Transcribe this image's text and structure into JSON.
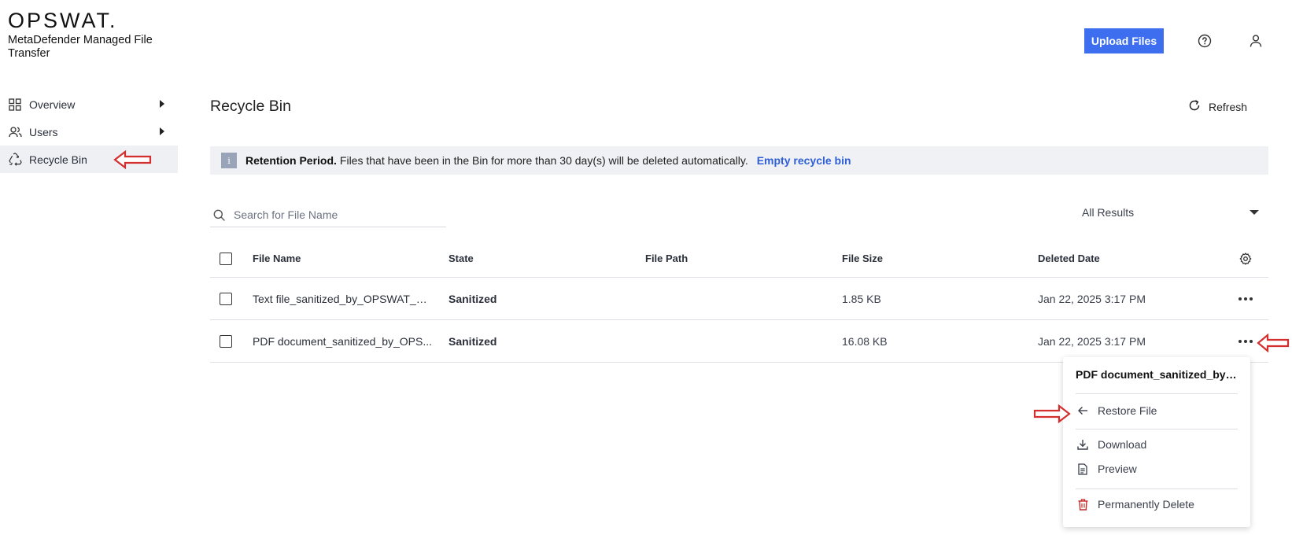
{
  "brand": {
    "logo": "OPSWAT.",
    "product": "MetaDefender Managed File Transfer"
  },
  "topbar": {
    "upload_label": "Upload Files",
    "help_icon": "help-circle-icon",
    "user_icon": "user-icon"
  },
  "sidebar": {
    "items": [
      {
        "label": "Overview",
        "icon": "grid-icon",
        "expandable": true
      },
      {
        "label": "Users",
        "icon": "users-icon",
        "expandable": true
      },
      {
        "label": "Recycle Bin",
        "icon": "recycle-icon",
        "active": true
      }
    ]
  },
  "page": {
    "title": "Recycle Bin",
    "refresh_label": "Refresh"
  },
  "banner": {
    "icon": "i",
    "bold": "Retention Period.",
    "text": "Files that have been in the Bin for more than 30 day(s) will be deleted automatically.",
    "link": "Empty recycle bin"
  },
  "search": {
    "placeholder": "Search for File Name"
  },
  "filter": {
    "selected": "All Results"
  },
  "table": {
    "columns": [
      "File Name",
      "State",
      "File Path",
      "File Size",
      "Deleted Date"
    ],
    "rows": [
      {
        "name": "Text file_sanitized_by_OPSWAT_MetaDefender.txt",
        "name_display": "Text file_sanitized_by_OPSWAT_M...",
        "state": "Sanitized",
        "path": "",
        "size": "1.85 KB",
        "date": "Jan 22, 2025 3:17 PM"
      },
      {
        "name": "PDF document_sanitized_by_OPSWAT_MetaDefender.pdf",
        "name_display": "PDF document_sanitized_by_OPS...",
        "state": "Sanitized",
        "path": "",
        "size": "16.08 KB",
        "date": "Jan 22, 2025 3:17 PM"
      }
    ]
  },
  "menu": {
    "title": "PDF document_sanitized_by_O...",
    "items": [
      {
        "label": "Restore File",
        "icon": "arrow-left-icon"
      },
      {
        "label": "Download",
        "icon": "download-icon"
      },
      {
        "label": "Preview",
        "icon": "document-icon"
      },
      {
        "label": "Permanently Delete",
        "icon": "trash-icon",
        "color": "#c62828"
      }
    ]
  },
  "colors": {
    "accent": "#3d6ef0",
    "link": "#2e5fd6",
    "danger": "#c62828",
    "annotation": "#d32f2f"
  }
}
